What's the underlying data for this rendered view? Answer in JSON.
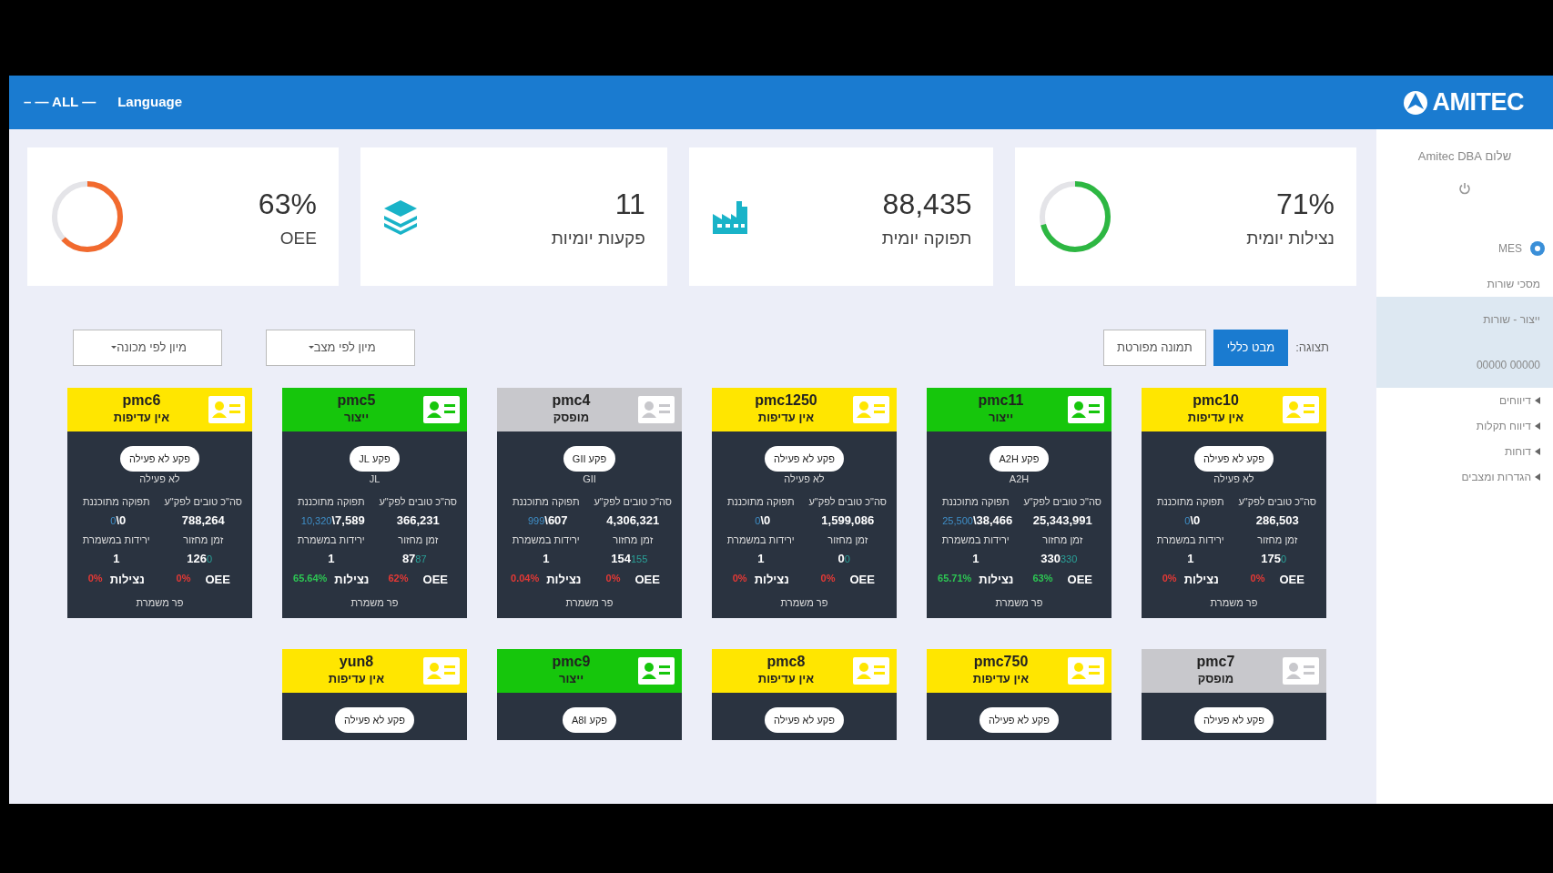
{
  "topbar": {
    "filter": "– — ALL —",
    "language": "Language",
    "logo": "AMITEC"
  },
  "stats": [
    {
      "kind": "donut",
      "value": "71%",
      "label": "נצילות יומית",
      "level": 0.71,
      "color": "#2db742"
    },
    {
      "kind": "factory",
      "value": "88,435",
      "label": "תפוקה יומית"
    },
    {
      "kind": "layers",
      "value": "11",
      "label": "פקעות יומיות"
    },
    {
      "kind": "donut",
      "value": "63%",
      "label": "OEE",
      "level": 0.63,
      "color": "#f26a2e"
    }
  ],
  "toolbar": {
    "label": "תצוגה:",
    "views": [
      {
        "label": "מבט כללי",
        "selected": true
      },
      {
        "label": "תמונה מפורטת",
        "selected": false
      }
    ],
    "sorts": [
      "מיון לפי מצב",
      "מיון לפי מכונה"
    ]
  },
  "machines": [
    {
      "name": "pmc10",
      "status": "אין עדיפות",
      "color": "#ffe600",
      "order": "פקע לא פעילה",
      "order_sub": "לא פעילה",
      "good_label": "סה\"כ טובים לפק\"ע",
      "good": "286,503",
      "planned_label": "תפוקה מתוכננת",
      "planned_target": "0",
      "planned": "0\\",
      "cycle_label": "זמן מחזור",
      "cycle": "175",
      "cycle_std": "0",
      "drops_label": "ירידות במשמרת",
      "drops": "1",
      "oee_label": "OEE",
      "oee": "0%",
      "oee_good": false,
      "util_label": "נצילות",
      "util": "0%",
      "util_good": false,
      "footer": "פר משמרת"
    },
    {
      "name": "pmc11",
      "status": "ייצור",
      "color": "#16c60c",
      "order": "פקע A2H",
      "order_sub": "A2H",
      "good_label": "סה\"כ טובים לפק\"ע",
      "good": "25,343,991",
      "planned_label": "תפוקה מתוכננת",
      "planned_target": "25,500",
      "planned": "38,466\\",
      "cycle_label": "זמן מחזור",
      "cycle": "330",
      "cycle_std": "330",
      "drops_label": "ירידות במשמרת",
      "drops": "1",
      "oee_label": "OEE",
      "oee": "63%",
      "oee_good": true,
      "util_label": "נצילות",
      "util": "65.71%",
      "util_good": true,
      "footer": "פר משמרת"
    },
    {
      "name": "pmc1250",
      "status": "אין עדיפות",
      "color": "#ffe600",
      "order": "פקע לא פעילה",
      "order_sub": "לא פעילה",
      "good_label": "סה\"כ טובים לפק\"ע",
      "good": "1,599,086",
      "planned_label": "תפוקה מתוכננת",
      "planned_target": "0",
      "planned": "0\\",
      "cycle_label": "זמן מחזור",
      "cycle": "0",
      "cycle_std": "0",
      "drops_label": "ירידות במשמרת",
      "drops": "1",
      "oee_label": "OEE",
      "oee": "0%",
      "oee_good": false,
      "util_label": "נצילות",
      "util": "0%",
      "util_good": false,
      "footer": "פר משמרת"
    },
    {
      "name": "pmc4",
      "status": "מופסק",
      "color": "#c8c8cc",
      "order": "פקע GII",
      "order_sub": "GII",
      "good_label": "סה\"כ טובים לפק\"ע",
      "good": "4,306,321",
      "planned_label": "תפוקה מתוכננת",
      "planned_target": "999",
      "planned": "607\\",
      "cycle_label": "זמן מחזור",
      "cycle": "154",
      "cycle_std": "155",
      "drops_label": "ירידות במשמרת",
      "drops": "1",
      "oee_label": "OEE",
      "oee": "0%",
      "oee_good": false,
      "util_label": "נצילות",
      "util": "0.04%",
      "util_good": false,
      "footer": "פר משמרת"
    },
    {
      "name": "pmc5",
      "status": "ייצור",
      "color": "#16c60c",
      "order": "פקע JL",
      "order_sub": "JL",
      "good_label": "סה\"כ טובים לפק\"ע",
      "good": "366,231",
      "planned_label": "תפוקה מתוכננת",
      "planned_target": "10,320",
      "planned": "7,589\\",
      "cycle_label": "זמן מחזור",
      "cycle": "87",
      "cycle_std": "87",
      "drops_label": "ירידות במשמרת",
      "drops": "1",
      "oee_label": "OEE",
      "oee": "62%",
      "oee_good": false,
      "util_label": "נצילות",
      "util": "65.64%",
      "util_good": true,
      "footer": "פר משמרת"
    },
    {
      "name": "pmc6",
      "status": "אין עדיפות",
      "color": "#ffe600",
      "order": "פקע לא פעילה",
      "order_sub": "לא פעילה",
      "good_label": "סה\"כ טובים לפק\"ע",
      "good": "788,264",
      "planned_label": "תפוקה מתוכננת",
      "planned_target": "0",
      "planned": "0\\",
      "cycle_label": "זמן מחזור",
      "cycle": "126",
      "cycle_std": "0",
      "drops_label": "ירידות במשמרת",
      "drops": "1",
      "oee_label": "OEE",
      "oee": "0%",
      "oee_good": false,
      "util_label": "נצילות",
      "util": "0%",
      "util_good": false,
      "footer": "פר משמרת"
    },
    {
      "name": "pmc7",
      "status": "מופסק",
      "color": "#c8c8cc",
      "order": "פקע לא פעילה"
    },
    {
      "name": "pmc750",
      "status": "אין עדיפות",
      "color": "#ffe600",
      "order": "פקע לא פעילה"
    },
    {
      "name": "pmc8",
      "status": "אין עדיפות",
      "color": "#ffe600",
      "order": "פקע לא פעילה"
    },
    {
      "name": "pmc9",
      "status": "ייצור",
      "color": "#16c60c",
      "order": "פקע A8I"
    },
    {
      "name": "yun8",
      "status": "אין עדיפות",
      "color": "#ffe600",
      "order": "פקע לא פעילה"
    }
  ],
  "sidebar": {
    "greeting": "שלום Amitec DBA",
    "module": "MES",
    "items": [
      {
        "label": "מסכי שורות",
        "kind": "plain"
      },
      {
        "label": "ייצור - שורות",
        "kind": "highlight"
      },
      {
        "label": "00000 00000",
        "kind": "highlight"
      },
      {
        "label": "דיווחים",
        "kind": "arrow"
      },
      {
        "label": "דיווח תקלות",
        "kind": "arrow"
      },
      {
        "label": "דוחות",
        "kind": "arrow"
      },
      {
        "label": "הגדרות ומצבים",
        "kind": "arrow"
      }
    ]
  }
}
